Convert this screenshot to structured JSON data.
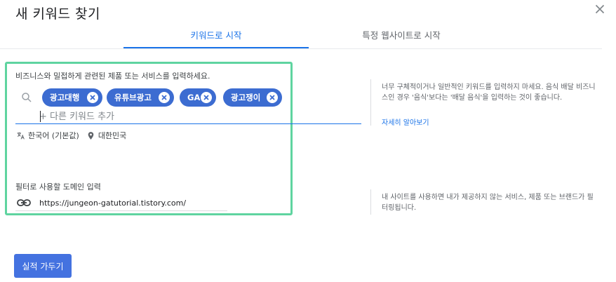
{
  "dialog": {
    "title": "새 키워드 찾기",
    "close_icon": "close-icon"
  },
  "tabs": [
    {
      "label": "키워드로 시작",
      "active": true
    },
    {
      "label": "특정 웹사이트로 시작",
      "active": false
    }
  ],
  "keywords_section": {
    "prompt": "비즈니스와 밀접하게 관련된 제품 또는 서비스를 입력하세요.",
    "search_icon": "search-icon",
    "chips": [
      {
        "label": "광고대행"
      },
      {
        "label": "유튜브광고"
      },
      {
        "label": "GA"
      },
      {
        "label": "광고쟁이"
      }
    ],
    "input_placeholder": "+ 다른 키워드 추가",
    "input_value": "",
    "language": "한국어 (기본값)",
    "location": "대한민국"
  },
  "keywords_help": {
    "text": "너무 구체적이거나 일반적인 키워드를 입력하지 마세요. 음식 배달 비즈니스인 경우 '음식'보다는 '배달 음식'을 입력하는 것이 좋습니다.",
    "link": "자세히 알아보기"
  },
  "domain_section": {
    "label": "필터로 사용할 도메인 입력",
    "value": "https://jungeon-gatutorial.tistory.com/",
    "link_icon": "link-icon"
  },
  "domain_help": {
    "text": "내 사이트를 사용하면 내가 제공하지 않는 서비스, 제품 또는 브랜드가 필터링됩니다."
  },
  "actions": {
    "primary_label": "실적 가두기"
  },
  "colors": {
    "accent": "#1a73e8",
    "chip": "#3c6cd1",
    "highlight": "#5fd4a0",
    "button": "#4472e0"
  }
}
